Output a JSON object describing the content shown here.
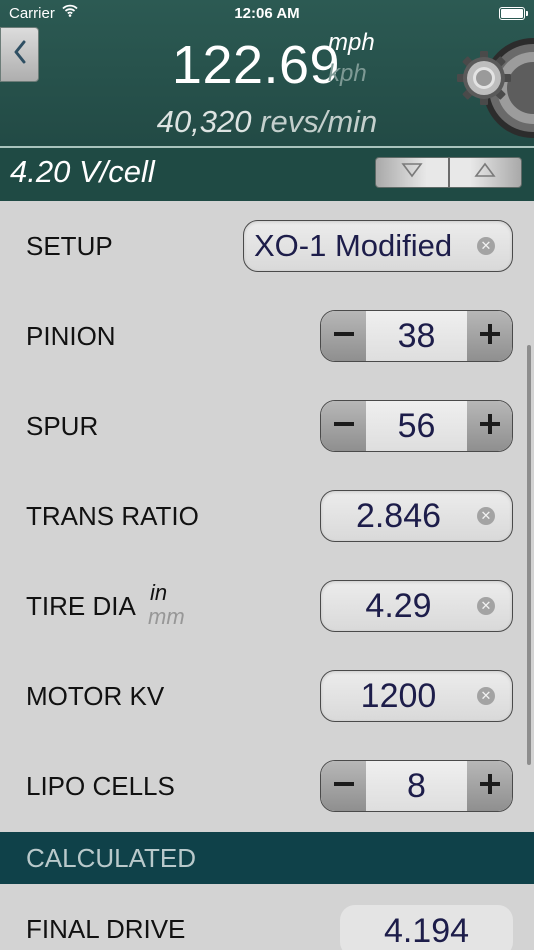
{
  "status_bar": {
    "carrier": "Carrier",
    "time": "12:06 AM"
  },
  "header": {
    "speed": "122.69",
    "unit_primary": "mph",
    "unit_secondary": "kph",
    "revs_value": "40,320",
    "revs_unit": "revs/min",
    "voltage": "4.20 V/cell"
  },
  "form": {
    "setup": {
      "label": "SETUP",
      "value": "XO-1 Modified"
    },
    "pinion": {
      "label": "PINION",
      "value": "38"
    },
    "spur": {
      "label": "SPUR",
      "value": "56"
    },
    "trans_ratio": {
      "label": "TRANS RATIO",
      "value": "2.846"
    },
    "tire_dia": {
      "label": "TIRE DIA",
      "unit_primary": "in",
      "unit_secondary": "mm",
      "value": "4.29"
    },
    "motor_kv": {
      "label": "MOTOR KV",
      "value": "1200"
    },
    "lipo_cells": {
      "label": "LIPO CELLS",
      "value": "8"
    }
  },
  "calculated": {
    "header": "CALCULATED",
    "final_drive": {
      "label": "FINAL DRIVE",
      "value": "4.194"
    }
  },
  "icons": {
    "back": "chevron-left-icon",
    "settings": "gear-icon",
    "clear": "clear-icon",
    "decrement": "minus-icon",
    "increment": "plus-icon",
    "volt_down": "triangle-down-icon",
    "volt_up": "triangle-up-icon"
  }
}
